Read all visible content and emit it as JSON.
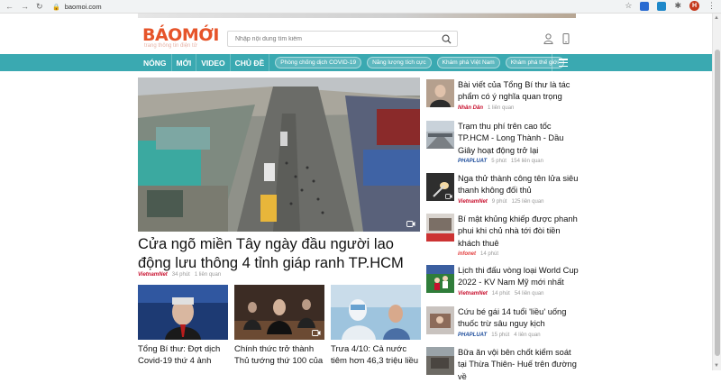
{
  "browser": {
    "url": "baomoi.com",
    "profile_initial": "H"
  },
  "header": {
    "logo_text": "BÁOMỚI",
    "tagline": "trang thông tin điện tử",
    "search_placeholder": "Nhập nội dung tìm kiếm"
  },
  "nav": {
    "main": [
      "NÓNG",
      "MỚI",
      "VIDEO",
      "CHỦ ĐỀ"
    ],
    "topics": [
      "Phòng chống dịch COVID-19",
      "Năng lượng tích cực",
      "Khám phá Việt Nam",
      "Khám phá thế giới"
    ]
  },
  "hero": {
    "title": "Cửa ngõ miền Tây ngày đầu người lao động lưu thông 4 tỉnh giáp ranh TP.HCM",
    "source": "VietnamNet",
    "time": "34 phút",
    "related": "1 liên quan"
  },
  "sub_articles": [
    {
      "title": "Tổng Bí thư: Đợt dịch Covid-19 thứ 4 ảnh"
    },
    {
      "title": "Chính thức trở thành Thủ tướng thứ 100 của"
    },
    {
      "title": "Trưa 4/10: Cả nước tiêm hơn 46,3 triệu liều"
    }
  ],
  "side_articles": [
    {
      "title": "Bài viết của Tổng Bí thư là tác phẩm có ý nghĩa quan trọng",
      "source": "Nhân Dân",
      "time": "1 liên quan",
      "source_color": "#c8102e"
    },
    {
      "title": "Trạm thu phí trên cao tốc TP.HCM - Long Thành - Dầu Giây hoạt động trở lại",
      "source": "PHAPLUAT",
      "time": "5 phút",
      "related": "154 liên quan",
      "source_color": "#1f4e9c"
    },
    {
      "title": "Nga thử thành công tên lửa siêu thanh không đối thủ",
      "source": "VietnamNet",
      "time": "9 phút",
      "related": "125 liên quan",
      "source_color": "#c8102e"
    },
    {
      "title": "Bí mật khủng khiếp được phanh phui khi chủ nhà tới đòi tiền khách thuê",
      "source": "infonet",
      "time": "14 phút",
      "source_color": "#e23b3b"
    },
    {
      "title": "Lịch thi đấu vòng loại World Cup 2022 - KV Nam Mỹ mới nhất",
      "source": "VietnamNet",
      "time": "14 phút",
      "related": "54 liên quan",
      "source_color": "#c8102e"
    },
    {
      "title": "Cứu bé gái 14 tuổi 'liều' uống thuốc trừ sâu nguy kịch",
      "source": "PHAPLUAT",
      "time": "15 phút",
      "related": "4 liên quan",
      "source_color": "#1f4e9c"
    },
    {
      "title": "Bữa ăn vội bên chốt kiểm soát tại Thừa Thiên- Huế trên đường về",
      "source": "",
      "time": "",
      "source_color": "#c8102e"
    }
  ],
  "colors": {
    "accent": "#3aa9b1",
    "logo": "#e6542a"
  }
}
